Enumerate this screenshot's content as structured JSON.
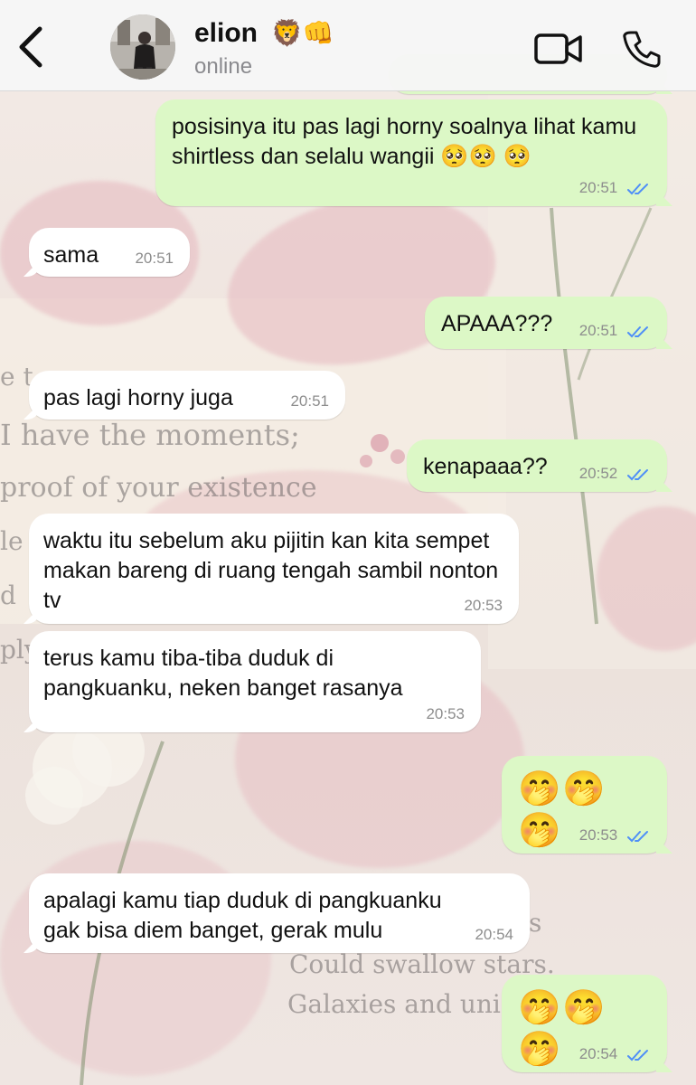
{
  "contact": {
    "name": "elion",
    "name_emoji": "🦁👊",
    "status": "online"
  },
  "icons": {
    "back": "chevron-left-icon",
    "video": "video-camera-icon",
    "call": "phone-icon",
    "read": "double-check-icon"
  },
  "colors": {
    "outgoing_bubble": "#dcf8c6",
    "incoming_bubble": "#ffffff",
    "read_tick": "#4f8ff7",
    "header_bg": "#f6f6f6"
  },
  "messages": [
    {
      "direction": "out",
      "text": "posisinya itu pas lagi horny soalnya lihat kamu shirtless dan selalu wangii 🥺🥺 🥺",
      "time": "20:51",
      "read": true
    },
    {
      "direction": "in",
      "text": "sama",
      "time": "20:51"
    },
    {
      "direction": "out",
      "text": "APAAA???",
      "time": "20:51",
      "read": true
    },
    {
      "direction": "in",
      "text": "pas lagi horny juga",
      "time": "20:51"
    },
    {
      "direction": "out",
      "text": "kenapaaa??",
      "time": "20:52",
      "read": true
    },
    {
      "direction": "in",
      "text": "waktu itu sebelum aku pijitin kan kita sempet makan bareng di ruang tengah sambil nonton tv",
      "time": "20:53"
    },
    {
      "direction": "in",
      "text": "terus kamu tiba-tiba duduk di pangkuanku, neken banget rasanya",
      "time": "20:53"
    },
    {
      "direction": "out",
      "text": "🤭🤭🤭",
      "time": "20:53",
      "read": true
    },
    {
      "direction": "in",
      "text": "apalagi kamu tiap duduk di pangkuanku gak bisa diem banget, gerak mulu",
      "time": "20:54"
    },
    {
      "direction": "out",
      "text": "🤭🤭🤭",
      "time": "20:54",
      "read": true
    }
  ],
  "wallpaper_text": [
    "e t",
    "I have the moments;",
    "proof of your existence",
    "le",
    "d",
    "ply",
    "s",
    "Could swallow stars.",
    "Galaxies and uni"
  ]
}
